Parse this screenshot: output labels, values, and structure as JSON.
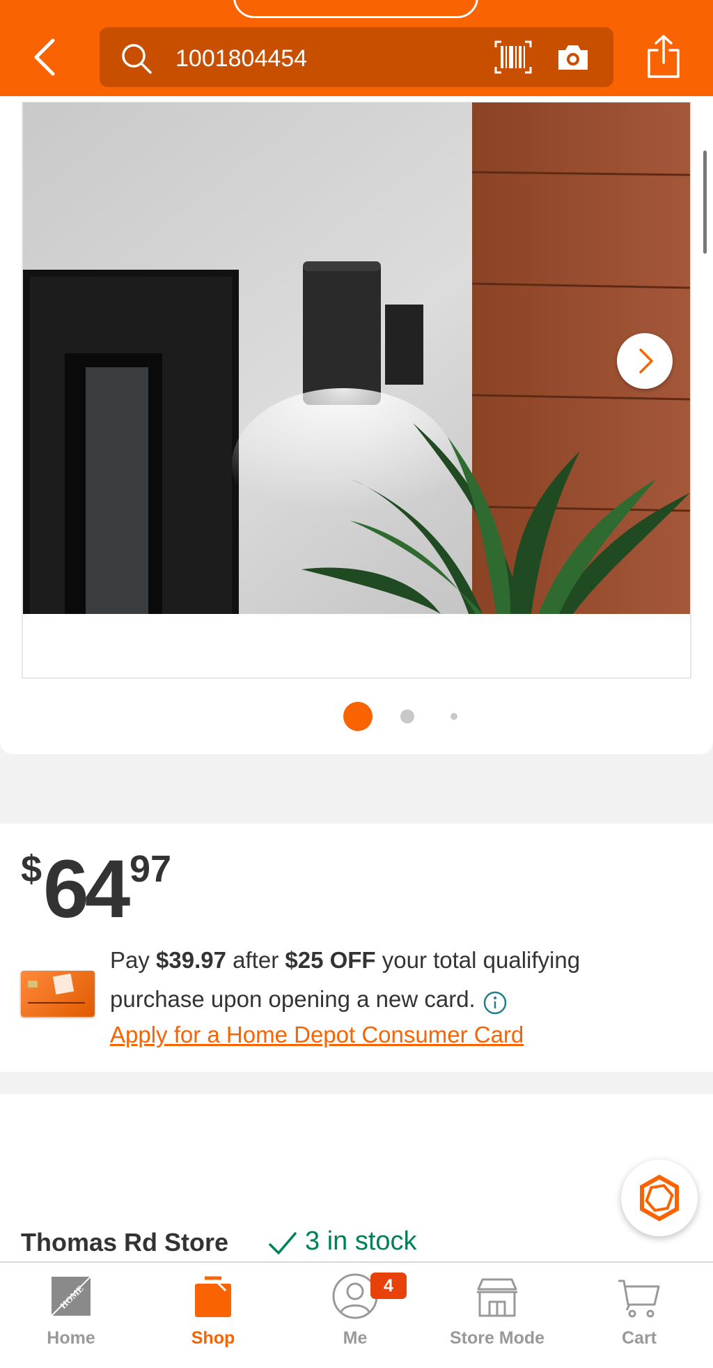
{
  "header": {
    "search_query": "1001804454",
    "back_icon": "chevron-left-icon",
    "search_icon": "search-icon",
    "barcode_icon": "barcode-icon",
    "camera_icon": "camera-icon",
    "share_icon": "share-icon",
    "brand_color": "#f96302"
  },
  "gallery": {
    "image_description": "black cylindrical outdoor wall light",
    "next_icon": "chevron-right-icon",
    "current_image": 1,
    "total_images": 3
  },
  "price": {
    "dollar_sign": "$",
    "whole": "64",
    "cents": "97"
  },
  "promo": {
    "pay_prefix": "Pay ",
    "pay_amount": "$39.97",
    "after_text": " after ",
    "discount": "$25 OFF",
    "rest_text": " your total qualifying purchase upon opening a new card.",
    "info_icon": "info-icon",
    "apply_link": "Apply for a Home Depot Consumer Card",
    "card_icon": "credit-card-icon"
  },
  "store": {
    "name": "Thomas Rd Store",
    "stock_text": "3 in stock",
    "stock_color": "#00805a"
  },
  "tab_bar": {
    "tabs": [
      {
        "label": "Home",
        "icon": "home-depot-logo-icon"
      },
      {
        "label": "Shop",
        "icon": "shop-bag-icon",
        "active": true
      },
      {
        "label": "Me",
        "icon": "user-icon",
        "badge": "4"
      },
      {
        "label": "Store Mode",
        "icon": "store-icon"
      },
      {
        "label": "Cart",
        "icon": "cart-icon"
      }
    ]
  }
}
